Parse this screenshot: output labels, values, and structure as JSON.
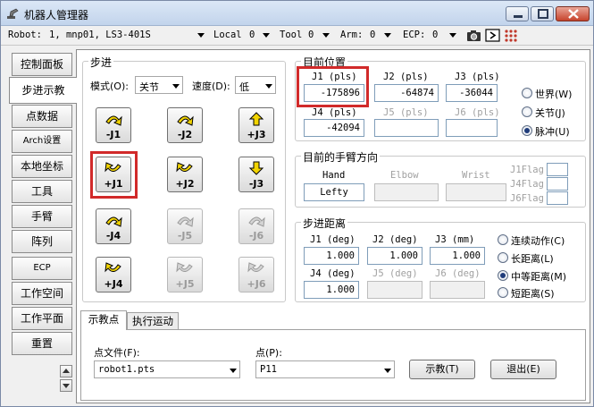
{
  "window": {
    "title": "机器人管理器"
  },
  "toolbar": {
    "robot_label": "Robot:",
    "robot_value": "1, mnp01, LS3-401S",
    "local_label": "Local",
    "local_value": "0",
    "tool_label": "Tool",
    "tool_value": "0",
    "arm_label": "Arm:",
    "arm_value": "0",
    "ecp_label": "ECP:",
    "ecp_value": "0",
    "icons": [
      "camera-icon",
      "play-icon",
      "io-grid-icon"
    ]
  },
  "side_tabs": [
    "控制面板",
    "步进示教",
    "点数据",
    "Arch设置",
    "本地坐标",
    "工具",
    "手臂",
    "阵列",
    "ECP",
    "工作空间",
    "工作平面",
    "重置"
  ],
  "active_tab": "步进示教",
  "jog": {
    "title": "步进",
    "mode_label": "模式(O):",
    "mode_value": "关节",
    "speed_label": "速度(D):",
    "speed_value": "低",
    "buttons": [
      "-J1",
      "-J2",
      "+J3",
      "+J1",
      "+J2",
      "-J3",
      "-J4",
      "-J5",
      "-J6",
      "+J4",
      "+J5",
      "+J6"
    ]
  },
  "position": {
    "title": "目前位置",
    "j1_label": "J1 (pls)",
    "j1_value": "-175896",
    "j2_label": "J2 (pls)",
    "j2_value": "-64874",
    "j3_label": "J3 (pls)",
    "j3_value": "-36044",
    "j4_label": "J4 (pls)",
    "j4_value": "-42094",
    "j5_label": "J5 (pls)",
    "j5_value": "",
    "j6_label": "J6 (pls)",
    "j6_value": "",
    "radios": [
      "世界(W)",
      "关节(J)",
      "脉冲(U)"
    ],
    "selected_radio": "脉冲(U)"
  },
  "arm_orientation": {
    "title": "目前的手臂方向",
    "hand_label": "Hand",
    "hand_value": "Lefty",
    "elbow_label": "Elbow",
    "elbow_value": "",
    "wrist_label": "Wrist",
    "wrist_value": "",
    "flags": [
      "J1Flag",
      "J4Flag",
      "J6Flag"
    ]
  },
  "step_distance": {
    "title": "步进距离",
    "j1_label": "J1 (deg)",
    "j1_value": "1.000",
    "j2_label": "J2 (deg)",
    "j2_value": "1.000",
    "j3_label": "J3 (mm)",
    "j3_value": "1.000",
    "j4_label": "J4 (deg)",
    "j4_value": "1.000",
    "j5_label": "J5 (deg)",
    "j5_value": "",
    "j6_label": "J6 (deg)",
    "j6_value": "",
    "radios": [
      "连续动作(C)",
      "长距离(L)",
      "中等距离(M)",
      "短距离(S)"
    ],
    "selected_radio": "中等距离(M)"
  },
  "bottom_tabs": [
    "示教点",
    "执行运动"
  ],
  "teach": {
    "file_label": "点文件(F):",
    "file_value": "robot1.pts",
    "point_label": "点(P):",
    "point_value": "P11",
    "teach_button": "示教(T)",
    "exit_button": "退出(E)"
  },
  "colors": {
    "highlight": "#d12a2a",
    "arrow_yellow": "#f2d400",
    "titlebar": "#c2d4ec"
  }
}
